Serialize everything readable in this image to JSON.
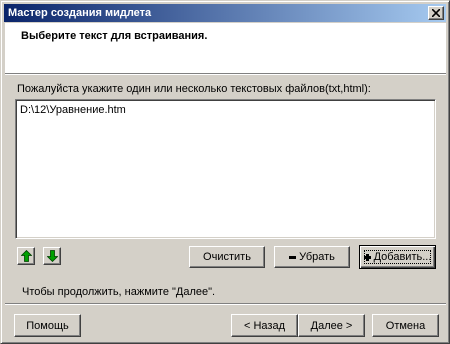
{
  "window": {
    "title": "Мастер создания мидлета"
  },
  "header": {
    "title": "Выберите текст для встраивания."
  },
  "instruction": "Пожалуйста укажите один или несколько текстовых файлов(txt,html):",
  "files": [
    "D:\\12\\Уравнение.htm"
  ],
  "list_buttons": {
    "move_up_icon": "arrow-up-icon",
    "move_down_icon": "arrow-down-icon",
    "clear_label": "Очистить",
    "remove_label": "Убрать",
    "add_label": "Добавить..."
  },
  "status_text": "Чтобы продолжить, нажмите \"Далее\".",
  "footer": {
    "help_label": "Помощь",
    "back_label": "< Назад",
    "next_label": "Далее >",
    "cancel_label": "Отмена"
  },
  "colors": {
    "title_gradient_start": "#0a246a",
    "title_gradient_end": "#a6caf0",
    "face": "#d4d0c8",
    "arrow_green": "#00a000"
  }
}
